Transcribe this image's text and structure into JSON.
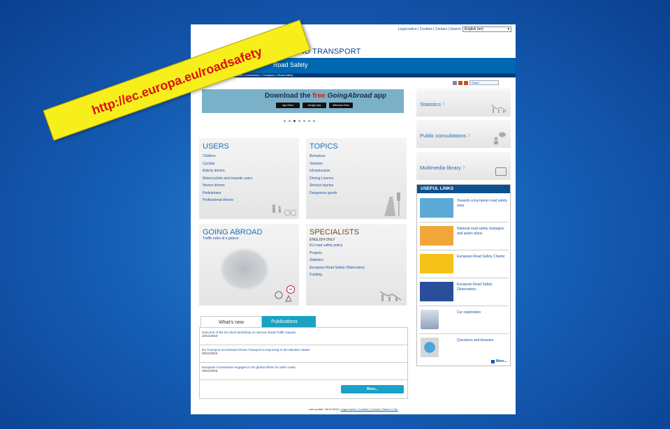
{
  "top": {
    "links": "Legal notice | Cookies | Contact | Search",
    "language": "English (en)"
  },
  "site": {
    "title": "BILITY AND TRANSPORT",
    "subtitle": "Road Safety",
    "breadcrumb": "European Commission > Transport > Road Safety"
  },
  "share_label": "Share",
  "banner": {
    "before": "Download the ",
    "free": "free ",
    "app": "GoingAbroad",
    "after": " app",
    "stores": [
      "App Store",
      "Google play",
      "Windows Store"
    ]
  },
  "users": {
    "title": "USERS",
    "items": [
      "Children",
      "Cyclists",
      "Elderly drivers",
      "Motorcyclists and mopeds users",
      "Novice drivers",
      "Pedestrians",
      "Professional drivers"
    ]
  },
  "topics": {
    "title": "TOPICS",
    "items": [
      "Behaviour",
      "Vehicles",
      "Infrastructure",
      "Driving Licence",
      "Serious injuries",
      "Dangerous goods"
    ]
  },
  "abroad": {
    "title": "GOING ABROAD",
    "link": "Traffic rules at a glance",
    "sign": "50"
  },
  "specialists": {
    "title": "SPECIALISTS",
    "note": "ENGLISH ONLY",
    "items": [
      "EU road safety policy",
      "Projects",
      "Statistics",
      "European Road Safety Observatory",
      "Funding"
    ]
  },
  "tabs": {
    "whats_new": "What's new",
    "publications": "Publications"
  },
  "news": [
    {
      "title": "Outcome of the EU-level Workshop on Serious Road Traffic Injuries",
      "date": "10/12/2015"
    },
    {
      "title": "EU Transport Scoreboard shows Transport is improving in the Member States",
      "date": "20/11/2015"
    },
    {
      "title": "European Commission engages in UN global efforts for safer roads",
      "date": "18/11/2015"
    }
  ],
  "news_more": "More...",
  "footer": {
    "updated": "Last update: 04/11/2015 | ",
    "links": "Legal notice | Cookies | Contact | Search | Top"
  },
  "right": {
    "statistics": "Statistics",
    "consultations": "Public consultations",
    "multimedia": "Multimedia library"
  },
  "useful": {
    "title": "USEFUL LINKS",
    "items": [
      "Towards a European road safety area",
      "National road safety strategies and action plans",
      "European Road Safety Charter",
      "European Road Safety Observatory",
      "Car registration",
      "Questions and Answers"
    ],
    "more": "More..."
  },
  "ribbon": "http://ec.europa.eu/roadsafety",
  "colors": {
    "header_blue": "#0067b1",
    "tab_teal": "#19a2c4",
    "ribbon_yellow": "#f7ef1c",
    "ribbon_text": "#e00d0d"
  }
}
